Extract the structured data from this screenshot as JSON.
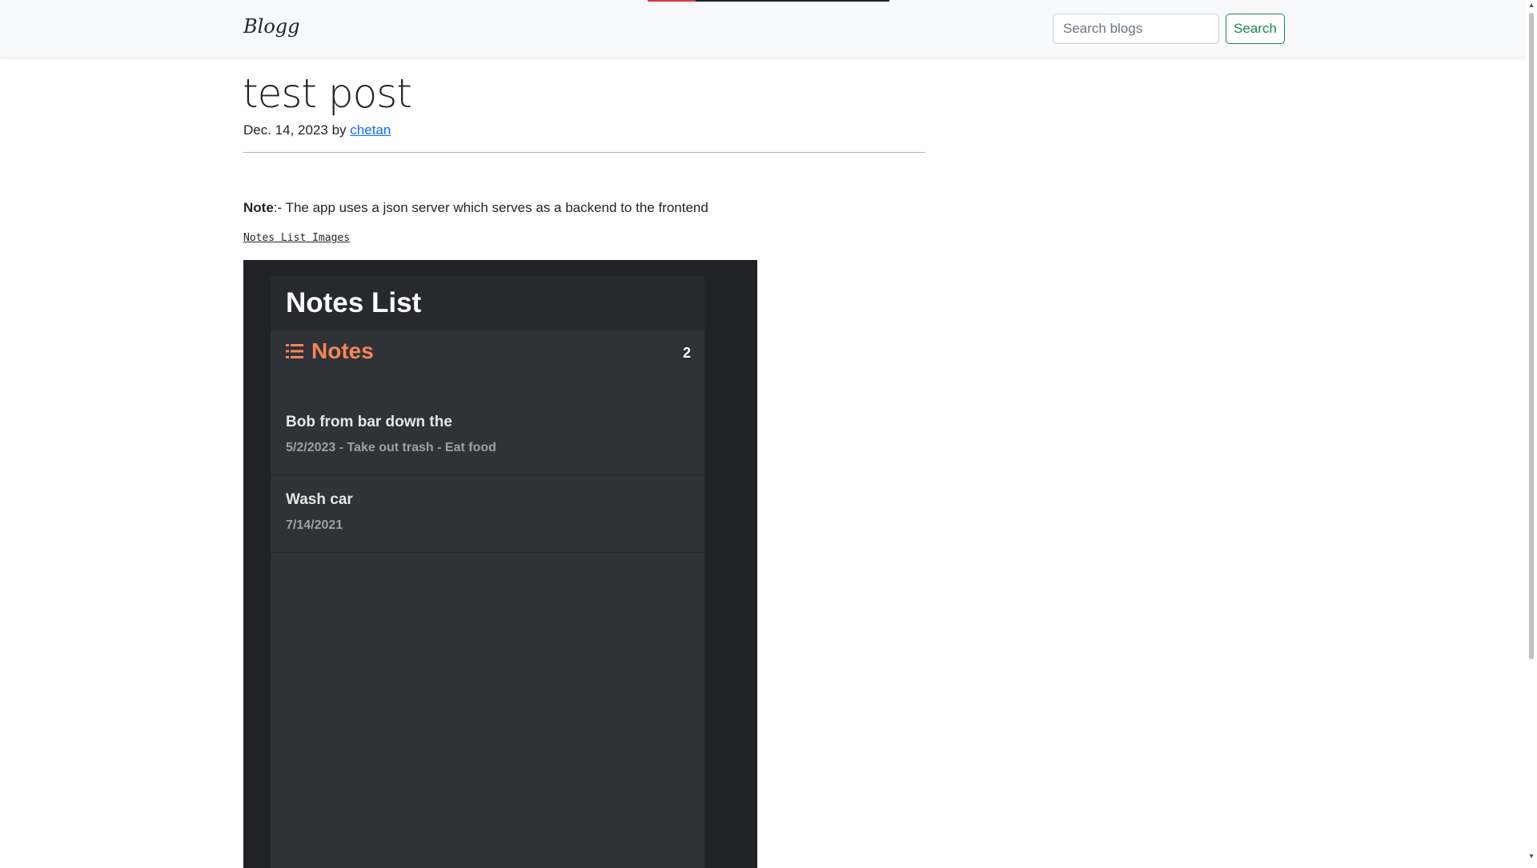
{
  "navbar": {
    "brand": "Blogg",
    "search_placeholder": "Search blogs",
    "search_button": "Search"
  },
  "post": {
    "title": "test post",
    "date": "Dec. 14, 2023",
    "by": "by",
    "author": "chetan",
    "note_label": "Note",
    "note_text": ":- The app uses a json server which serves as a backend to the frontend",
    "section_link": "Notes List Images"
  },
  "embedded_app": {
    "title": "Notes List",
    "notes_label": "Notes",
    "notes_count": "2",
    "accent_color": "#f68657",
    "items": [
      {
        "title": "Bob from bar down the",
        "subtitle": "5/2/2023  - Take out trash - Eat food"
      },
      {
        "title": "Wash car",
        "subtitle": "7/14/2021"
      }
    ]
  },
  "colors": {
    "navbar_bg": "#f8f9fa",
    "search_button": "#198754",
    "link": "#0d6efd"
  }
}
